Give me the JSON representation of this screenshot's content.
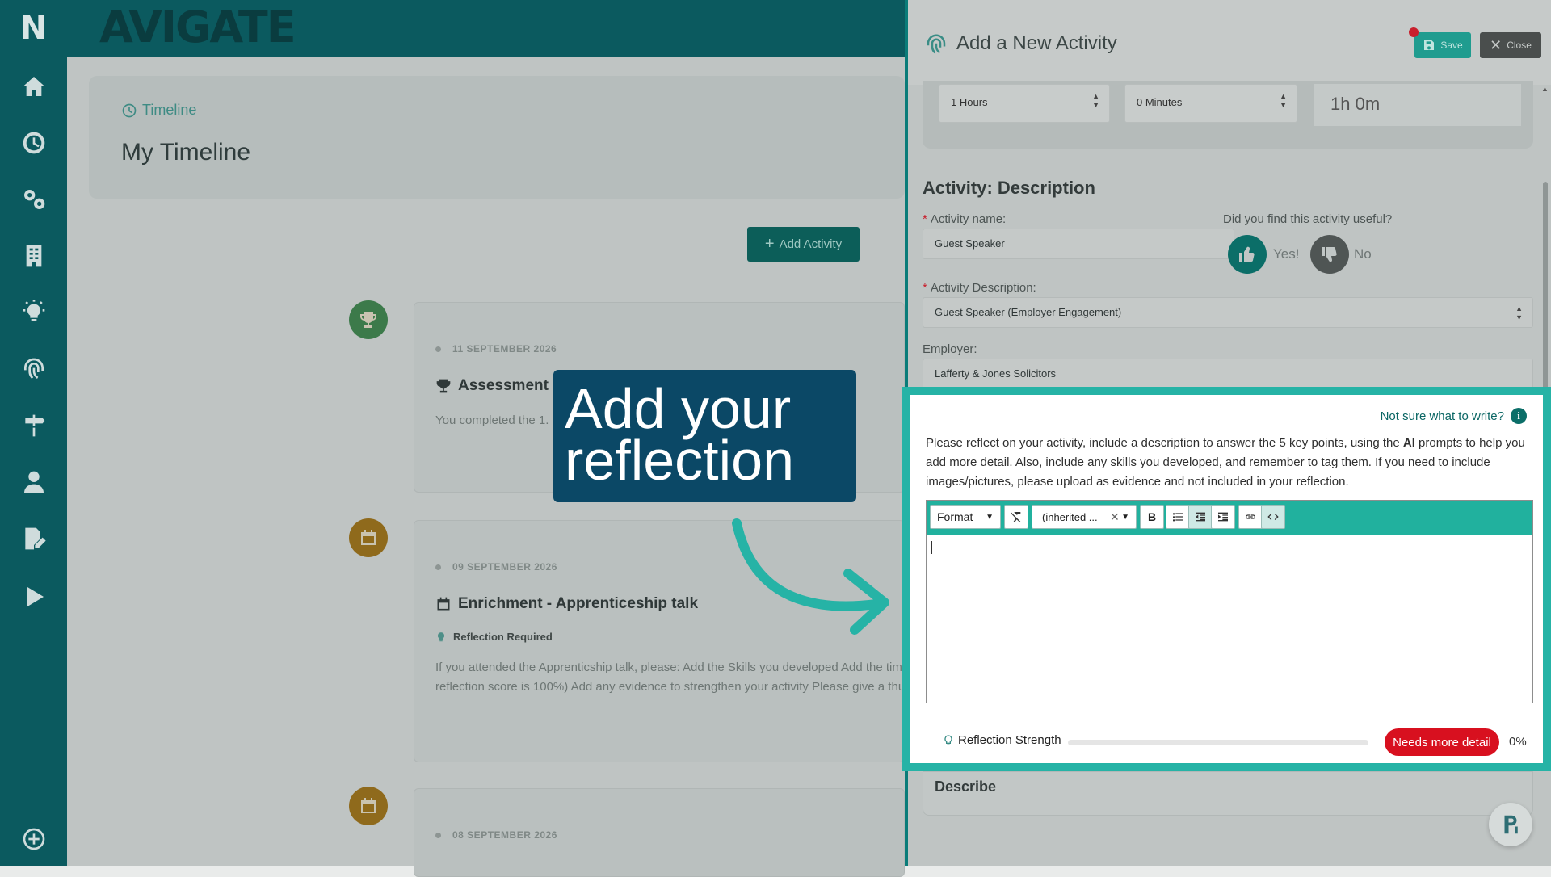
{
  "sidebar": {
    "logo": "N",
    "items": [
      {
        "name": "home-icon"
      },
      {
        "name": "clock-icon"
      },
      {
        "name": "cogs-icon"
      },
      {
        "name": "building-icon"
      },
      {
        "name": "lightbulb-icon"
      },
      {
        "name": "fingerprint-icon"
      },
      {
        "name": "signpost-icon"
      },
      {
        "name": "user-icon"
      },
      {
        "name": "edit-document-icon"
      },
      {
        "name": "play-icon"
      },
      {
        "name": "plus-circle-icon"
      }
    ]
  },
  "app": {
    "brand": "AVIGATE",
    "breadcrumb": "Timeline",
    "page_title": "My Timeline",
    "add_activity": "Add Activity"
  },
  "timeline": [
    {
      "date": "11 SEPTEMBER 2026",
      "title": "Assessment (",
      "text": "You completed the 1. S",
      "badge_color": "#3c7a4a",
      "icon": "trophy-icon"
    },
    {
      "date": "09 SEPTEMBER 2026",
      "title": "Enrichment - Apprenticeship talk",
      "flag": "Reflection Required",
      "text_lines": [
        "If you attended the Apprenticship talk, please: Add the Skills you developed Add the tim",
        "reflection score is 100%) Add any evidence to strengthen your activity Please give a thu"
      ],
      "badge_color": "#8f6a1c",
      "icon": "calendar-icon"
    },
    {
      "date": "08 SEPTEMBER 2026",
      "badge_color": "#8f6a1c",
      "icon": "calendar-icon"
    }
  ],
  "callout": {
    "line1": "Add your",
    "line2": "reflection"
  },
  "panel": {
    "title": "Add a New Activity",
    "save": "Save",
    "close": "Close",
    "duration": {
      "hours": "1 Hours",
      "minutes": "0 Minutes",
      "total": "1h 0m"
    },
    "section_title": "Activity: Description",
    "activity_name_label": "Activity name:",
    "activity_name_value": "Guest Speaker",
    "useful_label": "Did you find this activity useful?",
    "useful_yes": "Yes!",
    "useful_no": "No",
    "description_label": "Activity Description:",
    "description_value": "Guest Speaker (Employer Engagement)",
    "employer_label": "Employer:",
    "employer_value": "Lafferty & Jones Solicitors",
    "hint": "Not sure what to write?",
    "instructions_pre": "Please reflect on your activity, include a description to answer the 5 key points, using the ",
    "instructions_ai": "AI",
    "instructions_post": " prompts to help you add more detail. Also, include any skills you developed, and remember to tag them. If you need to include images/pictures, please upload as evidence and not included in your reflection.",
    "toolbar": {
      "format": "Format",
      "font": "(inherited ...",
      "bold": "B"
    },
    "strength_label": "Reflection Strength",
    "strength_status": "Needs more detail",
    "strength_percent": "0%",
    "strength_value": 0,
    "describe": "Describe"
  },
  "colors": {
    "teal": "#0b5a5f",
    "accent": "#21b19e",
    "highlight": "#26b3a6",
    "danger": "#d8101f",
    "callout": "#0b4866"
  }
}
